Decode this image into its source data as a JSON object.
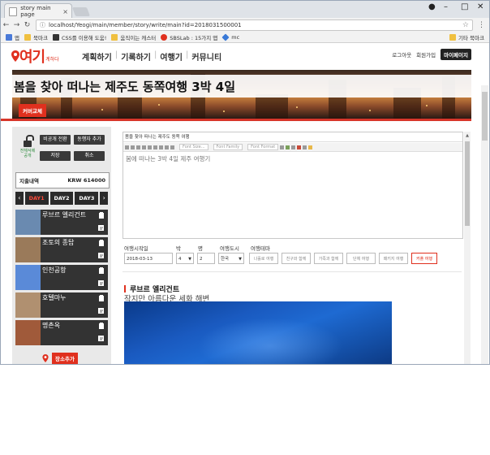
{
  "browser": {
    "tab_title": "story main page",
    "url": "localhost/Yeogi/main/member/story/write/main?id=2018031500001",
    "bookmarks": [
      "앱",
      "북마크",
      "CSS를 이용해 도움!",
      "움직이는 캐스터",
      "SBSLab : 15가지 앱",
      "mc"
    ],
    "bookmarks_right": "기타 북마크"
  },
  "site": {
    "logo_big": "여기",
    "logo_small": "계하다",
    "nav": [
      "계획하기",
      "기록하기",
      "여행기",
      "커뮤니티"
    ],
    "toplinks": {
      "logout": "로그아웃",
      "join": "회원가입",
      "mypage": "마이페이지"
    }
  },
  "banner": {
    "title": "봄을 찾아 떠나는 제주도 동쪽여행 3박 4일",
    "cover_button": "커버교체"
  },
  "sidebar": {
    "lock_label": "전체삭제 공개",
    "buttons": {
      "private": "비공개 전환",
      "companion": "동행자 추가",
      "save": "저장",
      "cancel": "취소"
    },
    "expense_label": "지출내역",
    "expense_value": "KRW 614000",
    "days": [
      "DAY1",
      "DAY2",
      "DAY3"
    ],
    "active_day": "DAY1",
    "places": [
      {
        "name": "루브르 엘리건트",
        "thumb_color": "#6a8ab0"
      },
      {
        "name": "조토의 종탑",
        "thumb_color": "#9a7a5a"
      },
      {
        "name": "인천공항",
        "thumb_color": "#5a8ad8"
      },
      {
        "name": "호텔마누",
        "thumb_color": "#b09070"
      },
      {
        "name": "명촌옥",
        "thumb_color": "#a05a3a"
      }
    ],
    "add_place": "장소추가"
  },
  "editor": {
    "title": "봄을 찾아 떠나는 제주도 동쪽 여행",
    "font_size": "Font Size...",
    "font_family": "Font Family",
    "font_format": "Font Format",
    "body": "봄에 떠나는 3박 4일 제주 여행기"
  },
  "form": {
    "labels": {
      "start": "여행시작일",
      "nights": "박",
      "people": "명",
      "city": "여행도시",
      "theme": "여행테마"
    },
    "start_value": "2018-03-13",
    "nights_value": "4",
    "people_value": "2",
    "city_value": "한국",
    "themes": [
      "나홀로 여행",
      "친구와 함께",
      "가족과 함께",
      "단체 여행",
      "패키지 여행",
      "커플 여행"
    ],
    "selected_theme": "커플 여행"
  },
  "place_detail": {
    "heading": "루브르 엘리건트",
    "description": "작지만 아름다운 세화 해변"
  },
  "colors": {
    "accent": "#e0301e",
    "dark": "#2a2a2a"
  }
}
